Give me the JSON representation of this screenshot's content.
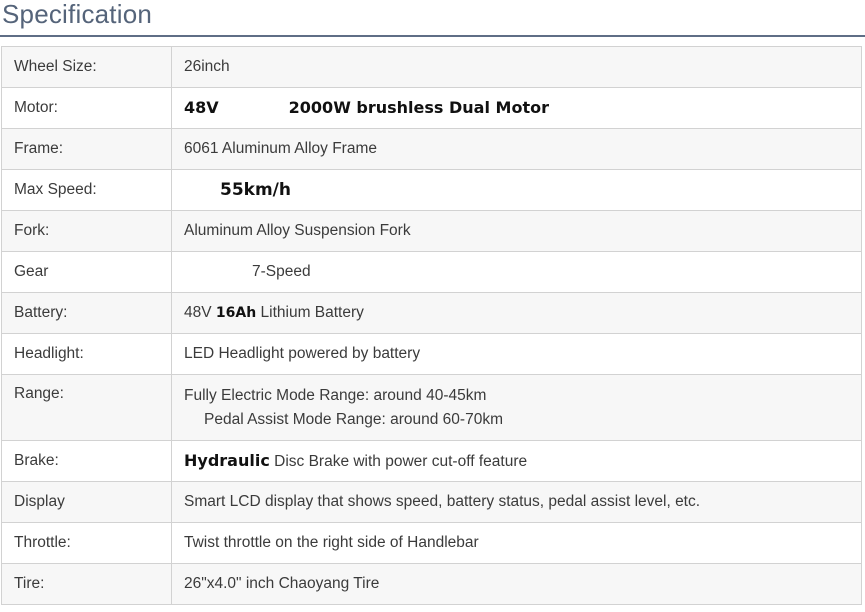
{
  "heading": "Specification",
  "rows": [
    {
      "label": "Wheel Size:",
      "value": "26inch"
    },
    {
      "label": "Motor:",
      "value_a": "48V",
      "value_b": "2000W brushless Dual Motor"
    },
    {
      "label": "Frame:",
      "value": "6061 Aluminum Alloy Frame"
    },
    {
      "label": "Max Speed:",
      "value": "55km/h"
    },
    {
      "label": "Fork:",
      "value": "Aluminum Alloy Suspension Fork"
    },
    {
      "label": "Gear",
      "value": "7-Speed"
    },
    {
      "label": "Battery:",
      "value_a": "48V",
      "value_b": "16Ah",
      "value_c": "Lithium Battery"
    },
    {
      "label": "Headlight:",
      "value": "LED Headlight powered by battery"
    },
    {
      "label": "Range:",
      "line1": "Fully Electric Mode Range: around 40-45km",
      "line2": "Pedal Assist Mode Range: around 60-70km"
    },
    {
      "label": "Brake:",
      "value_a": "Hydraulic",
      "value_b": "Disc Brake with power cut-off feature"
    },
    {
      "label": "Display",
      "value": "Smart LCD display that shows speed, battery status, pedal assist level, etc."
    },
    {
      "label": "Throttle:",
      "value": "Twist throttle on the right side of Handlebar"
    },
    {
      "label": "Tire:",
      "value": "26\"x4.0\" inch Chaoyang Tire"
    }
  ]
}
